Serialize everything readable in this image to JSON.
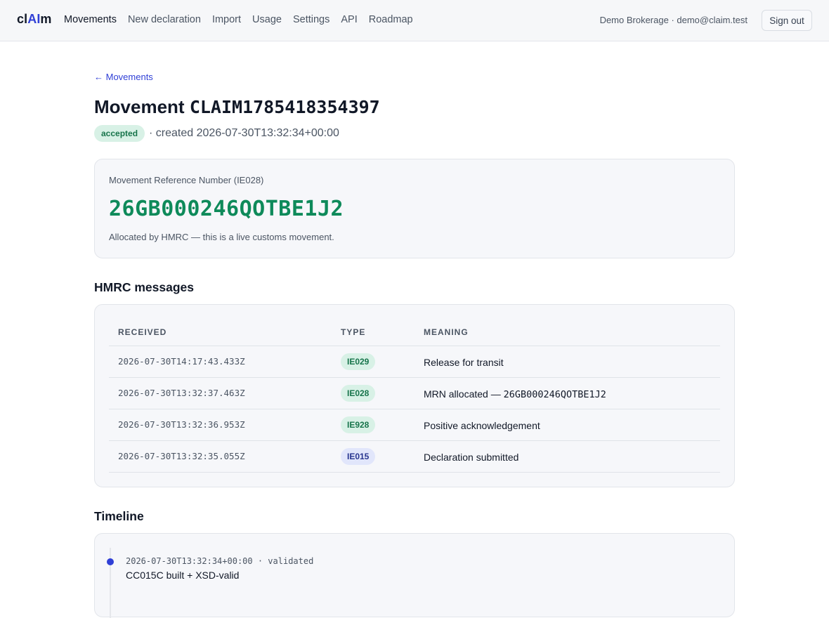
{
  "app": {
    "brand_prefix": "cl",
    "brand_highlight": "AI",
    "brand_suffix": "m"
  },
  "nav": {
    "items": [
      {
        "label": "Movements",
        "active": true
      },
      {
        "label": "New declaration",
        "active": false
      },
      {
        "label": "Import",
        "active": false
      },
      {
        "label": "Usage",
        "active": false
      },
      {
        "label": "Settings",
        "active": false
      },
      {
        "label": "API",
        "active": false
      },
      {
        "label": "Roadmap",
        "active": false
      }
    ],
    "account": "Demo Brokerage · demo@claim.test",
    "sign_out": "Sign out"
  },
  "page": {
    "back_link": "← Movements",
    "title_prefix": "Movement",
    "movement_id": "CLAIM1785418354397",
    "status_badge": "accepted",
    "created_text": "· created 2026-07-30T13:32:34+00:00"
  },
  "mrn": {
    "label": "Movement Reference Number (IE028)",
    "value": "26GB000246QOTBE1J2",
    "note": "Allocated by HMRC — this is a live customs movement."
  },
  "messages": {
    "section_title": "HMRC messages",
    "columns": [
      "RECEIVED",
      "TYPE",
      "MEANING"
    ],
    "rows": [
      {
        "received": "2026-07-30T14:17:43.433Z",
        "type": "IE029",
        "meaning": "Release for transit",
        "meaning_code": ""
      },
      {
        "received": "2026-07-30T13:32:37.463Z",
        "type": "IE028",
        "meaning": "MRN allocated — ",
        "meaning_code": "26GB000246QOTBE1J2"
      },
      {
        "received": "2026-07-30T13:32:36.953Z",
        "type": "IE928",
        "meaning": "Positive acknowledgement",
        "meaning_code": ""
      },
      {
        "received": "2026-07-30T13:32:35.055Z",
        "type": "IE015",
        "meaning": "Declaration submitted",
        "meaning_code": ""
      }
    ]
  },
  "timeline": {
    "section_title": "Timeline",
    "events": [
      {
        "meta": "2026-07-30T13:32:34+00:00 · validated",
        "text": "CC015C built + XSD-valid"
      }
    ]
  },
  "colors": {
    "accent": "#2f3fd6",
    "success": "#0e8a5a",
    "success_badge_bg": "#d8f1e6",
    "info_badge_bg": "#e1e6fb"
  }
}
